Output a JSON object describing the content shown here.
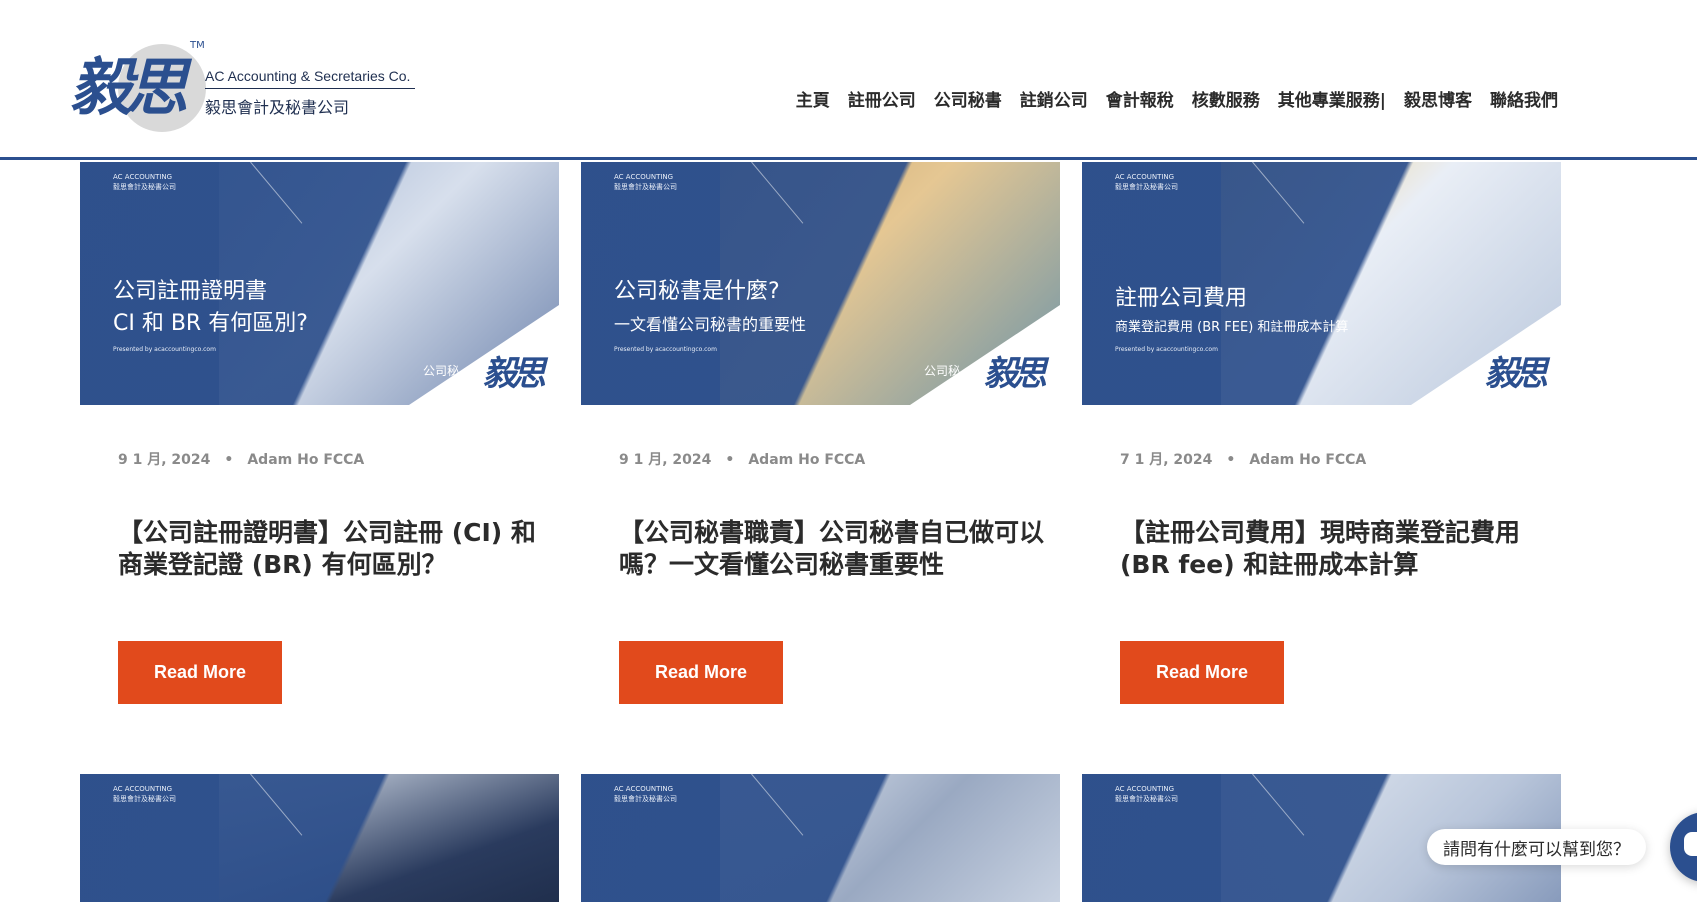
{
  "header": {
    "logo": {
      "glyph": "毅思",
      "tm": "TM",
      "name_en": "AC Accounting & Secretaries Co.",
      "name_zh": "毅思會計及秘書公司"
    },
    "nav": [
      "主頁",
      "註冊公司",
      "公司秘書",
      "註銷公司",
      "會計報稅",
      "核數服務",
      "其他專業服務|",
      "毅思博客",
      "聯絡我們"
    ]
  },
  "posts": [
    {
      "thumb_brand_en": "AC ACCOUNTING",
      "thumb_brand_zh": "毅思會計及秘書公司",
      "thumb_title_1": "公司註冊證明書",
      "thumb_title_2": "CI 和 BR 有何區別?",
      "thumb_presented": "Presented by acaccountingco.com",
      "thumb_corner_label": "公司秘",
      "date": "9 1 月, 2024",
      "author": "Adam Ho FCCA",
      "title": "【公司註冊證明書】公司註冊 (CI) 和 商業登記證 (BR) 有何區別？",
      "button": "Read More"
    },
    {
      "thumb_brand_en": "AC ACCOUNTING",
      "thumb_brand_zh": "毅思會計及秘書公司",
      "thumb_title_1": "公司秘書是什麼?",
      "thumb_title_2": "一文看懂公司秘書的重要性",
      "thumb_presented": "Presented by acaccountingco.com",
      "thumb_corner_label": "公司秘",
      "date": "9 1 月, 2024",
      "author": "Adam Ho FCCA",
      "title": "【公司秘書職責】公司秘書自已做可以嗎？一文看懂公司秘書重要性",
      "button": "Read More"
    },
    {
      "thumb_brand_en": "AC ACCOUNTING",
      "thumb_brand_zh": "毅思會計及秘書公司",
      "thumb_title_1": "註冊公司費用",
      "thumb_title_2": "商業登記費用 (BR FEE) 和註冊成本計算",
      "thumb_presented": "Presented by acaccountingco.com",
      "thumb_corner_label": "",
      "date": "7 1 月, 2024",
      "author": "Adam Ho FCCA",
      "title": "【註冊公司費用】現時商業登記費用 (BR fee) 和註冊成本計算",
      "button": "Read More"
    }
  ],
  "next_row": [
    {
      "thumb_brand_en": "AC ACCOUNTING",
      "thumb_brand_zh": "毅思會計及秘書公司"
    },
    {
      "thumb_brand_en": "AC ACCOUNTING",
      "thumb_brand_zh": "毅思會計及秘書公司"
    },
    {
      "thumb_brand_en": "AC ACCOUNTING",
      "thumb_brand_zh": "毅思會計及秘書公司"
    }
  ],
  "chat": {
    "prompt": "請問有什麼可以幫到您？"
  },
  "colors": {
    "brand_blue": "#2b4f8f",
    "button_orange": "#e14a1c",
    "meta_gray": "#8a8a8a"
  },
  "seal_text": "毅思"
}
